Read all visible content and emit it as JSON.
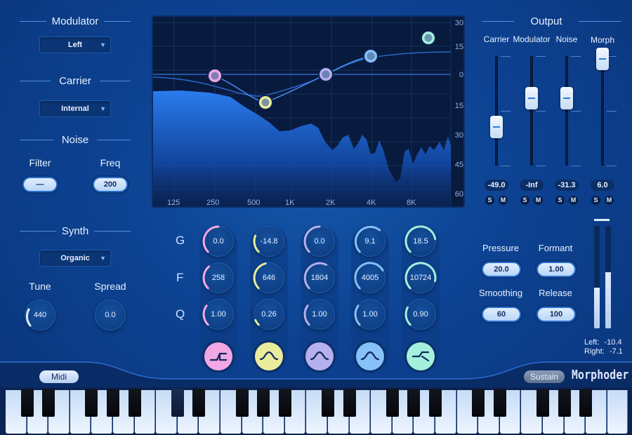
{
  "colors": {
    "pink": "#f2a8e4",
    "yellow": "#e9ec9c",
    "lavender": "#b6b0ee",
    "sky": "#86c1f8",
    "mint": "#a4f0dc",
    "accent": "#2a7be0"
  },
  "modulator": {
    "title": "Modulator",
    "dropdown": "Left"
  },
  "carrier": {
    "title": "Carrier",
    "dropdown": "Internal"
  },
  "noise": {
    "title": "Noise",
    "filter_label": "Filter",
    "filter_value": "—",
    "freq_label": "Freq",
    "freq_value": "200"
  },
  "synth": {
    "title": "Synth",
    "dropdown": "Organic",
    "tune_label": "Tune",
    "tune_value": "440",
    "spread_label": "Spread",
    "spread_value": "0.0"
  },
  "eq_display": {
    "x_ticks": [
      "125",
      "250",
      "500",
      "1K",
      "2K",
      "4K",
      "8K"
    ],
    "y_ticks": [
      "30",
      "15",
      "0",
      "15",
      "30",
      "45",
      "60"
    ],
    "bands": [
      {
        "id": "band1",
        "color": "pink"
      },
      {
        "id": "band2",
        "color": "yellow"
      },
      {
        "id": "band3",
        "color": "lavender"
      },
      {
        "id": "band4",
        "color": "sky"
      },
      {
        "id": "band5",
        "color": "mint"
      }
    ]
  },
  "eq_rows": {
    "g": "G",
    "f": "F",
    "q": "Q"
  },
  "eq_knobs": [
    {
      "g": "0.0",
      "f": "258",
      "q": "1.00",
      "g_level": 0.5,
      "f_level": 0.35,
      "q_level": 0.3,
      "filter": "highpass",
      "color": "pink"
    },
    {
      "g": "-14.8",
      "f": "646",
      "q": "0.26",
      "g_level": 0.25,
      "f_level": 0.45,
      "q_level": 0.08,
      "filter": "bell-down",
      "color": "yellow"
    },
    {
      "g": "0.0",
      "f": "1804",
      "q": "1.00",
      "g_level": 0.5,
      "f_level": 0.6,
      "q_level": 0.3,
      "filter": "bell",
      "color": "lavender"
    },
    {
      "g": "9.1",
      "f": "4005",
      "q": "1.00",
      "g_level": 0.65,
      "f_level": 0.72,
      "q_level": 0.3,
      "filter": "bell",
      "color": "sky"
    },
    {
      "g": "18.5",
      "f": "10724",
      "q": "0.90",
      "g_level": 0.8,
      "f_level": 0.88,
      "q_level": 0.27,
      "filter": "lowpass",
      "color": "mint"
    }
  ],
  "output": {
    "title": "Output",
    "channels": [
      {
        "label": "Carrier",
        "value": "-49.0",
        "s": "S",
        "m": "M",
        "level": 0.22
      },
      {
        "label": "Modulator",
        "value": "-Inf",
        "s": "S",
        "m": "M",
        "level": 0.55
      },
      {
        "label": "Noise",
        "value": "-31.3",
        "s": "S",
        "m": "M",
        "level": 0.55
      },
      {
        "label": "Morph",
        "value": "6.0",
        "s": "S",
        "m": "M",
        "level": 1.0
      }
    ]
  },
  "controls": {
    "pressure_label": "Pressure",
    "pressure_value": "20.0",
    "formant_label": "Formant",
    "formant_value": "1.00",
    "smoothing_label": "Smoothing",
    "smoothing_value": "60",
    "release_label": "Release",
    "release_value": "100"
  },
  "meters": {
    "left_label": "Left:",
    "left_value": "-10.4",
    "right_label": "Right:",
    "right_value": "-7.1",
    "left_level": 0.4,
    "right_level": 0.55
  },
  "footer": {
    "midi": "Midi",
    "sustain": "Sustain",
    "brand": "Morphoder"
  }
}
